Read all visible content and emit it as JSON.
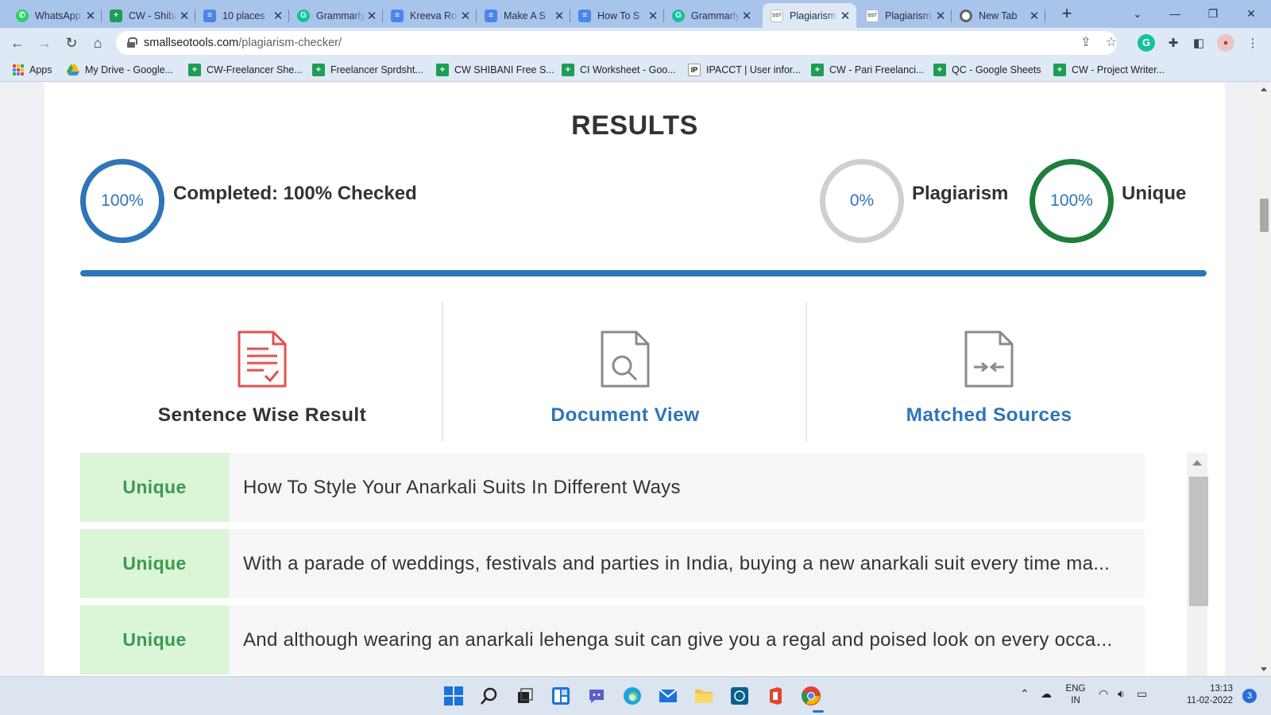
{
  "browser": {
    "tabs": [
      {
        "title": "WhatsApp",
        "icon": "whatsapp-icon"
      },
      {
        "title": "CW - Shibani",
        "icon": "google-sheets-icon"
      },
      {
        "title": "10 places",
        "icon": "google-docs-icon"
      },
      {
        "title": "Grammarly",
        "icon": "grammarly-icon"
      },
      {
        "title": "Kreeva Ro",
        "icon": "google-docs-icon"
      },
      {
        "title": "Make A S",
        "icon": "google-docs-icon"
      },
      {
        "title": "How To S",
        "icon": "google-docs-icon"
      },
      {
        "title": "Grammarly",
        "icon": "grammarly-icon"
      },
      {
        "title": "Plagiarism",
        "icon": "sst-icon"
      },
      {
        "title": "Plagiarism",
        "icon": "sst-icon"
      },
      {
        "title": "New Tab",
        "icon": "chrome-icon"
      }
    ],
    "active_tab_index": 8,
    "url_host": "smallseotools.com",
    "url_path": "/plagiarism-checker/",
    "bookmarks": [
      {
        "label": "Apps",
        "icon": "apps-grid-icon"
      },
      {
        "label": "My Drive - Google...",
        "icon": "google-drive-icon"
      },
      {
        "label": "CW-Freelancer She...",
        "icon": "google-sheets-icon"
      },
      {
        "label": "Freelancer Sprdsht...",
        "icon": "google-sheets-icon"
      },
      {
        "label": "CW SHIBANI Free S...",
        "icon": "google-sheets-icon"
      },
      {
        "label": "CI Worksheet - Goo...",
        "icon": "google-sheets-icon"
      },
      {
        "label": "IPACCT | User infor...",
        "icon": "ipacct-icon"
      },
      {
        "label": "CW - Pari Freelanci...",
        "icon": "google-sheets-icon"
      },
      {
        "label": "QC - Google Sheets",
        "icon": "google-sheets-icon"
      },
      {
        "label": "CW - Project Writer...",
        "icon": "google-sheets-icon"
      }
    ]
  },
  "results": {
    "title": "RESULTS",
    "completed": {
      "percent_text": "100%",
      "label": "Completed: 100% Checked",
      "fraction": 1.0
    },
    "plagiarism": {
      "percent_text": "0%",
      "label": "Plagiarism"
    },
    "unique": {
      "percent_text": "100%",
      "label": "Unique"
    },
    "views": [
      {
        "label": "Sentence Wise Result",
        "icon": "sentence-result-icon",
        "active": true
      },
      {
        "label": "Document View",
        "icon": "document-search-icon",
        "active": false
      },
      {
        "label": "Matched Sources",
        "icon": "matched-sources-icon",
        "active": false
      }
    ],
    "sentences": [
      {
        "status": "Unique",
        "text": "How To Style Your Anarkali Suits In Different Ways"
      },
      {
        "status": "Unique",
        "text": "With a parade of weddings, festivals and parties in India, buying a new anarkali suit every time ma..."
      },
      {
        "status": "Unique",
        "text": "And although wearing an anarkali lehenga suit can give you a regal and poised look on every occa..."
      }
    ]
  },
  "colors": {
    "accent": "#2e75b8",
    "unique_green": "#1e7e3e",
    "badge_bg": "#dbf5d7",
    "badge_text": "#3c9a4f",
    "sentence_icon_red": "#e0524f"
  },
  "taskbar": {
    "language": "ENG",
    "region": "IN",
    "time": "13:13",
    "date": "11-02-2022",
    "notification_count": "3"
  }
}
